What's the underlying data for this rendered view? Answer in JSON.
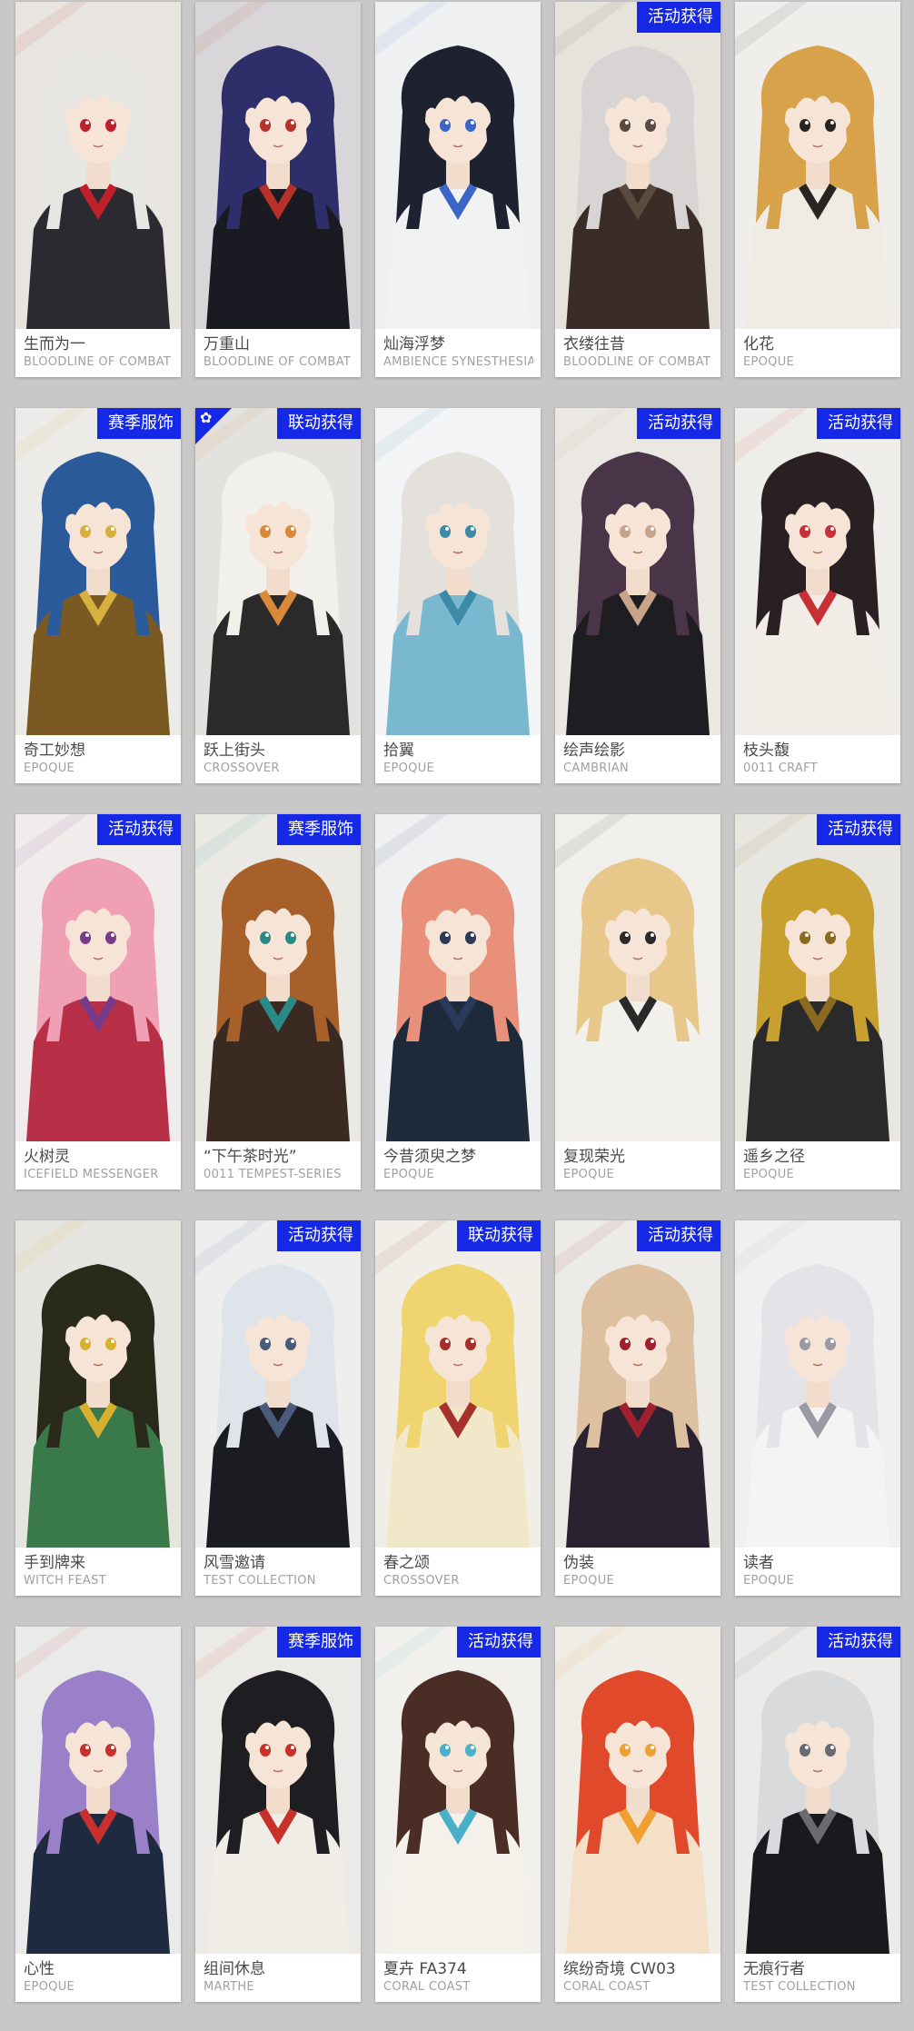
{
  "colors": {
    "background": "#c8c8c8",
    "badge_blue": "#1428e6",
    "name_text": "#4a4a4a",
    "brand_text": "#a0a0a0"
  },
  "cards": [
    {
      "name": "生而为一",
      "brand": "BLOODLINE OF COMBAT",
      "badge": "",
      "art": {
        "bg": "#e8e4df",
        "hair": "#e8e6e2",
        "cloth": "#2a2a30",
        "accent": "#c0202a"
      }
    },
    {
      "name": "万重山",
      "brand": "BLOODLINE OF COMBAT",
      "badge": "",
      "art": {
        "bg": "#d8d6d8",
        "hair": "#2e2f6a",
        "cloth": "#1a1a22",
        "accent": "#b8302a"
      }
    },
    {
      "name": "灿海浮梦",
      "brand": "AMBIENCE SYNESTHESIA",
      "badge": "",
      "art": {
        "bg": "#eef0f2",
        "hair": "#1e2230",
        "cloth": "#f2f2f2",
        "accent": "#3a66c8"
      }
    },
    {
      "name": "衣缕往昔",
      "brand": "BLOODLINE OF COMBAT",
      "badge": "活动获得",
      "art": {
        "bg": "#e6e2dc",
        "hair": "#d8d4d4",
        "cloth": "#3a2c26",
        "accent": "#5a4a40"
      }
    },
    {
      "name": "化花",
      "brand": "EPOQUE",
      "badge": "",
      "art": {
        "bg": "#efeeea",
        "hair": "#d8a24a",
        "cloth": "#f0ece4",
        "accent": "#2a2420"
      }
    },
    {
      "name": "奇工妙想",
      "brand": "EPOQUE",
      "badge": "赛季服饰",
      "art": {
        "bg": "#ecebe8",
        "hair": "#2a5a9a",
        "cloth": "#7a5a22",
        "accent": "#d8b040"
      }
    },
    {
      "name": "跃上街头",
      "brand": "CROSSOVER",
      "badge": "联动获得",
      "corner": "✿",
      "art": {
        "bg": "#e4e2de",
        "hair": "#f2f0ea",
        "cloth": "#2a2a2a",
        "accent": "#d88a3a"
      }
    },
    {
      "name": "拾翼",
      "brand": "EPOQUE",
      "badge": "",
      "art": {
        "bg": "#f2f4f6",
        "hair": "#e4e0dc",
        "cloth": "#7ab8d0",
        "accent": "#3a8aa8"
      }
    },
    {
      "name": "绘声绘影",
      "brand": "CAMBRIAN",
      "badge": "活动获得",
      "art": {
        "bg": "#ebe8e4",
        "hair": "#4a3448",
        "cloth": "#1e1e22",
        "accent": "#c8a48a"
      }
    },
    {
      "name": "枝头馥",
      "brand": "0011 CRAFT",
      "badge": "活动获得",
      "art": {
        "bg": "#efedea",
        "hair": "#2a2024",
        "cloth": "#f2ece6",
        "accent": "#c83038"
      }
    },
    {
      "name": "火树灵",
      "brand": "ICEFIELD MESSENGER",
      "badge": "活动获得",
      "art": {
        "bg": "#f0eceb",
        "hair": "#f0a0b4",
        "cloth": "#b83048",
        "accent": "#7a3a8a"
      }
    },
    {
      "name": "“下午茶时光”",
      "brand": "0011 TEMPEST-SERIES",
      "badge": "赛季服饰",
      "art": {
        "bg": "#ebe9e4",
        "hair": "#a8602a",
        "cloth": "#3a2a22",
        "accent": "#2a8a88"
      }
    },
    {
      "name": "今昔须臾之梦",
      "brand": "EPOQUE",
      "badge": "",
      "art": {
        "bg": "#eef0f2",
        "hair": "#e8907a",
        "cloth": "#1e2a3a",
        "accent": "#2a3a5a"
      }
    },
    {
      "name": "复现荣光",
      "brand": "EPOQUE",
      "badge": "",
      "art": {
        "bg": "#f0efec",
        "hair": "#e8c88a",
        "cloth": "#f2f0ea",
        "accent": "#2a2a2a"
      }
    },
    {
      "name": "遥乡之径",
      "brand": "EPOQUE",
      "badge": "活动获得",
      "art": {
        "bg": "#e8e6e0",
        "hair": "#c8a030",
        "cloth": "#2a2a2a",
        "accent": "#8a6a20"
      }
    },
    {
      "name": "手到牌来",
      "brand": "WITCH FEAST",
      "badge": "",
      "art": {
        "bg": "#e6e4de",
        "hair": "#2a2a1a",
        "cloth": "#3a7a4a",
        "accent": "#d8b030"
      }
    },
    {
      "name": "风雪邀请",
      "brand": "TEST COLLECTION",
      "badge": "活动获得",
      "art": {
        "bg": "#eeeeee",
        "hair": "#dfe4ea",
        "cloth": "#1a1c22",
        "accent": "#4a5a7a"
      }
    },
    {
      "name": "春之颂",
      "brand": "CROSSOVER",
      "badge": "联动获得",
      "art": {
        "bg": "#f0eee6",
        "hair": "#f0d470",
        "cloth": "#f0e8c8",
        "accent": "#a8302a"
      }
    },
    {
      "name": "伪装",
      "brand": "EPOQUE",
      "badge": "活动获得",
      "art": {
        "bg": "#ecebe8",
        "hair": "#dcc0a0",
        "cloth": "#2a2230",
        "accent": "#a02030"
      }
    },
    {
      "name": "读者",
      "brand": "EPOQUE",
      "badge": "",
      "art": {
        "bg": "#f0f0f0",
        "hair": "#e4e4e8",
        "cloth": "#f4f4f4",
        "accent": "#9a9aa4"
      }
    },
    {
      "name": "心性",
      "brand": "EPOQUE",
      "badge": "",
      "art": {
        "bg": "#ebeaea",
        "hair": "#9a80c8",
        "cloth": "#1e2a40",
        "accent": "#c83030"
      }
    },
    {
      "name": "组间休息",
      "brand": "MARTHE",
      "badge": "赛季服饰",
      "art": {
        "bg": "#eceae6",
        "hair": "#1e1e22",
        "cloth": "#f0ece6",
        "accent": "#c8302a"
      }
    },
    {
      "name": "夏卉 FA374",
      "brand": "CORAL COAST",
      "badge": "活动获得",
      "art": {
        "bg": "#f2f0ec",
        "hair": "#4a2e26",
        "cloth": "#f4f0ea",
        "accent": "#48b0c8"
      }
    },
    {
      "name": "缤纷奇境 CW03",
      "brand": "CORAL COAST",
      "badge": "",
      "art": {
        "bg": "#f0ece6",
        "hair": "#e04a2a",
        "cloth": "#f4e0c8",
        "accent": "#f0a030"
      }
    },
    {
      "name": "无痕行者",
      "brand": "TEST COLLECTION",
      "badge": "活动获得",
      "art": {
        "bg": "#ecebea",
        "hair": "#d8dadc",
        "cloth": "#1a1a1e",
        "accent": "#6a6a72"
      }
    }
  ]
}
